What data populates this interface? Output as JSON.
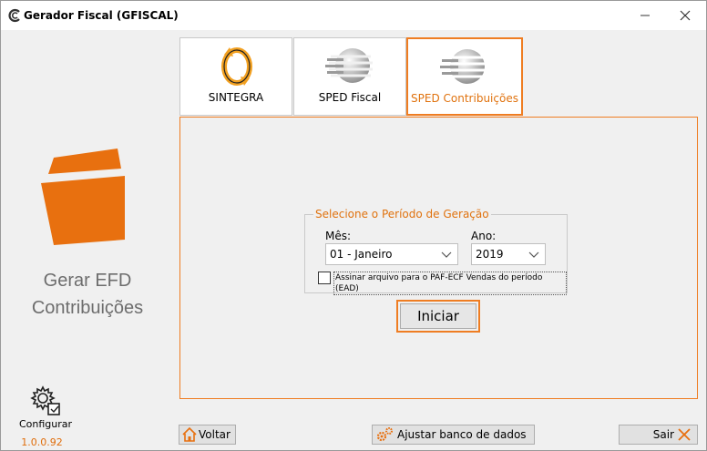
{
  "window": {
    "title": "Gerador Fiscal (GFISCAL)"
  },
  "left_panel": {
    "title_line1": "Gerar EFD",
    "title_line2": "Contribuições",
    "config_label": "Configurar",
    "version": "1.0.0.92"
  },
  "tabs": [
    {
      "label": "SINTEGRA",
      "icon": "sintegra-icon",
      "active": false
    },
    {
      "label": "SPED Fiscal",
      "icon": "sped-globe-icon",
      "active": false
    },
    {
      "label": "SPED Contribuições",
      "icon": "sped-globe-icon",
      "active": true
    }
  ],
  "period": {
    "legend": "Selecione o Período de Geração",
    "month_label": "Mês:",
    "month_value": "01 - Janeiro",
    "year_label": "Ano:",
    "year_value": "2019",
    "checkbox_label": "Assinar arquivo para o PAF-ECF Vendas do período (EAD)",
    "checkbox_checked": false
  },
  "start_button": "Iniciar",
  "bottom": {
    "back": "Voltar",
    "adjust_db": "Ajustar banco de dados",
    "exit": "Sair"
  },
  "colors": {
    "accent": "#ef7d22",
    "accent_text": "#e0720e",
    "background": "#f0f0f0"
  }
}
